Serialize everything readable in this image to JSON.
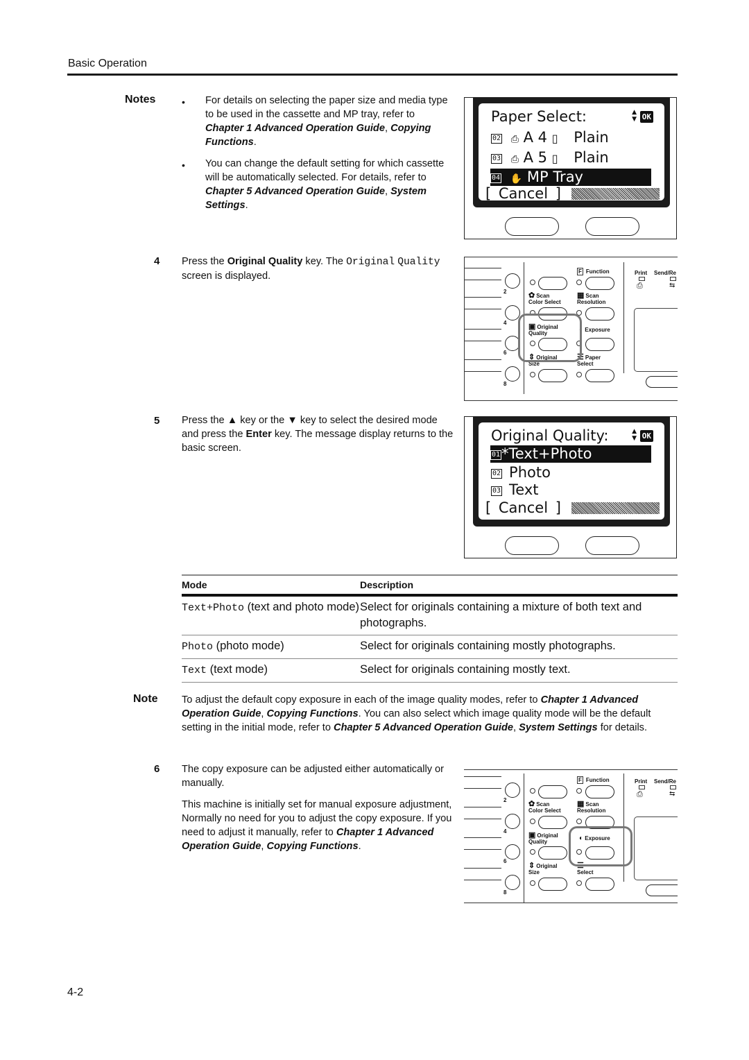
{
  "header": {
    "section_title": "Basic Operation"
  },
  "notes": {
    "label": "Notes",
    "items": [
      {
        "text_pre": "For details on selecting the paper size and media type to be used in the cassette and MP tray, refer to ",
        "ref1": "Chapter 1 Advanced Operation Guide",
        "sep": ", ",
        "ref2": "Copying Functions",
        "end": "."
      },
      {
        "text_pre": "You can change the default setting for which cassette will be automatically selected. For details, refer to ",
        "ref1": "Chapter 5 Advanced Operation Guide",
        "sep": ", ",
        "ref2": "System Settings",
        "end": "."
      }
    ]
  },
  "lcd_paper_select": {
    "title": "Paper Select:",
    "ok_label": "OK",
    "rows": [
      {
        "num": "02",
        "tray_icon": "cassette-1-icon",
        "size": "A 4",
        "media": "Plain",
        "selected": false
      },
      {
        "num": "03",
        "tray_icon": "cassette-2-icon",
        "size": "A 5",
        "media": "Plain",
        "selected": false
      },
      {
        "num": "04",
        "tray_icon": "mp-tray-hand-icon",
        "size": "MP Tray",
        "media": "",
        "selected": true
      }
    ],
    "cancel_label": "Cancel"
  },
  "steps": [
    {
      "num": "4",
      "pre": "Press the ",
      "bold": "Original Quality",
      "mid": " key. The ",
      "mono1": "Original",
      "mono2": "Quality",
      "post": " screen is displayed."
    },
    {
      "num": "5",
      "pre": "Press the ",
      "up": "▲",
      "mid1": " key or the ",
      "down": "▼",
      "mid2": " key to select the desired mode and press the ",
      "bold": "Enter",
      "post": " key. The message display returns to the basic screen."
    },
    {
      "num": "6",
      "p1": "The copy exposure can be adjusted either automatically or manually.",
      "p2_pre": "This machine is initially set for manual exposure adjustment, Normally no need for you to adjust the copy exposure. If you need to adjust it manually, refer to ",
      "ref1": "Chapter 1 Advanced Operation Guide",
      "sep": ", ",
      "ref2": "Copying Functions",
      "end": "."
    }
  ],
  "operation_panel": {
    "keys": {
      "function": "Function",
      "function_icon_letter": "F",
      "scan_color_select_1": "Scan",
      "scan_color_select_2": "Color Select",
      "scan_resolution_1": "Scan",
      "scan_resolution_2": "Resolution",
      "original_quality_1": "Original",
      "original_quality_2": "Quality",
      "exposure": "Exposure",
      "original_size_1": "Original",
      "original_size_2": "Size",
      "paper_select_1": "Paper",
      "paper_select_2": "Select",
      "print": "Print",
      "send_receive": "Send/Re"
    },
    "numbers": [
      "2",
      "4",
      "6",
      "8"
    ]
  },
  "lcd_original_quality": {
    "title": "Original Quality:",
    "ok_label": "OK",
    "rows": [
      {
        "num": "01",
        "label": "*Text+Photo",
        "selected": true
      },
      {
        "num": "02",
        "label": "Photo",
        "selected": false
      },
      {
        "num": "03",
        "label": "Text",
        "selected": false
      }
    ],
    "cancel_label": "Cancel"
  },
  "mode_table": {
    "headers": [
      "Mode",
      "Description"
    ],
    "rows": [
      {
        "mode_code": "Text+Photo",
        "mode_desc": " (text and photo mode)",
        "description": "Select for originals containing a mixture of both text and photographs."
      },
      {
        "mode_code": "Photo",
        "mode_desc": " (photo mode)",
        "description": "Select for originals containing mostly photographs."
      },
      {
        "mode_code": "Text",
        "mode_desc": " (text mode)",
        "description": "Select for originals containing mostly text."
      }
    ]
  },
  "note": {
    "label": "Note",
    "pre": "To adjust the default copy exposure in each of the image quality modes, refer to ",
    "ref1": "Chapter 1 Advanced Operation Guide",
    "sep1": ", ",
    "ref2": "Copying Functions",
    "mid": ". You can also select which image quality mode will be the default setting in the initial mode, refer to ",
    "ref3": "Chapter 5 Advanced Operation Guide",
    "sep2": ", ",
    "ref4": "System Settings",
    "post": " for details."
  },
  "footer": {
    "page_number": "4-2"
  }
}
